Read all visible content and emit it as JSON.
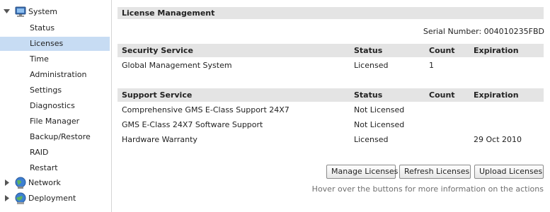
{
  "sidebar": {
    "system": {
      "label": "System",
      "expanded": true,
      "icon": "computer-icon"
    },
    "items": [
      {
        "label": "Status"
      },
      {
        "label": "Licenses",
        "selected": true
      },
      {
        "label": "Time"
      },
      {
        "label": "Administration"
      },
      {
        "label": "Settings"
      },
      {
        "label": "Diagnostics"
      },
      {
        "label": "File Manager"
      },
      {
        "label": "Backup/Restore"
      },
      {
        "label": "RAID"
      },
      {
        "label": "Restart"
      }
    ],
    "network": {
      "label": "Network",
      "expanded": false,
      "icon": "network-globe-icon"
    },
    "deployment": {
      "label": "Deployment",
      "expanded": false,
      "icon": "deployment-globe-icon"
    }
  },
  "main": {
    "title": "License Management",
    "serial": "Serial Number: 004010235FBD",
    "security": {
      "headers": [
        "Security Service",
        "Status",
        "Count",
        "Expiration"
      ],
      "rows": [
        {
          "service": "Global Management System",
          "status": "Licensed",
          "count": "1",
          "expiration": ""
        }
      ]
    },
    "support": {
      "headers": [
        "Support Service",
        "Status",
        "Count",
        "Expiration"
      ],
      "rows": [
        {
          "service": "Comprehensive GMS E-Class Support 24X7",
          "status": "Not Licensed",
          "count": "",
          "expiration": ""
        },
        {
          "service": "GMS E-Class 24X7 Software Support",
          "status": "Not Licensed",
          "count": "",
          "expiration": ""
        },
        {
          "service": "Hardware Warranty",
          "status": "Licensed",
          "count": "",
          "expiration": "29 Oct 2010"
        }
      ]
    },
    "buttons": {
      "manage": "Manage Licenses",
      "refresh": "Refresh Licenses",
      "upload": "Upload Licenses"
    },
    "hint": "Hover over the buttons for more information on the actions"
  },
  "colors": {
    "selected_row": "#c7dcf3",
    "header_bg": "#e4e4e4",
    "hint_text": "#6f6f6f"
  }
}
